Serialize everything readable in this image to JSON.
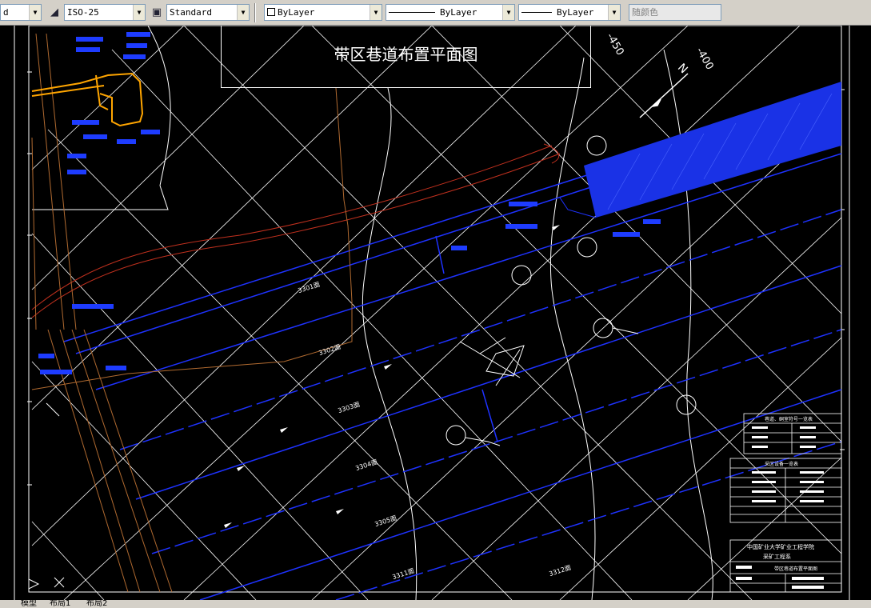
{
  "toolbar": {
    "layer_combo": "d",
    "dimstyle_combo": "ISO-25",
    "tablestyle_combo": "Standard",
    "color_combo": "ByLayer",
    "linetype_combo": "ByLayer",
    "lineweight_combo": "ByLayer",
    "plotstyle_combo": "随颜色"
  },
  "drawing": {
    "title": "带区巷道布置平面图",
    "labels": {
      "north": "N",
      "elev_450": "-450",
      "elev_400": "-400",
      "face_3301": "3301面",
      "face_3302": "3302面",
      "face_3303": "3303面",
      "face_3304": "3304面",
      "face_3305": "3305面",
      "face_3311": "3311面",
      "face_3312": "3312面"
    },
    "table_legend_title": "巷道、硐室符号一览表",
    "table_equipment_title": "采区设备一览表",
    "title_block": {
      "school": "中国矿业大学矿业工程学院",
      "department": "采矿工程系",
      "drawing_name": "带区巷道布置平面图"
    }
  },
  "tabs": {
    "model": "模型",
    "layout1": "布局1",
    "layout2": "布局2"
  }
}
